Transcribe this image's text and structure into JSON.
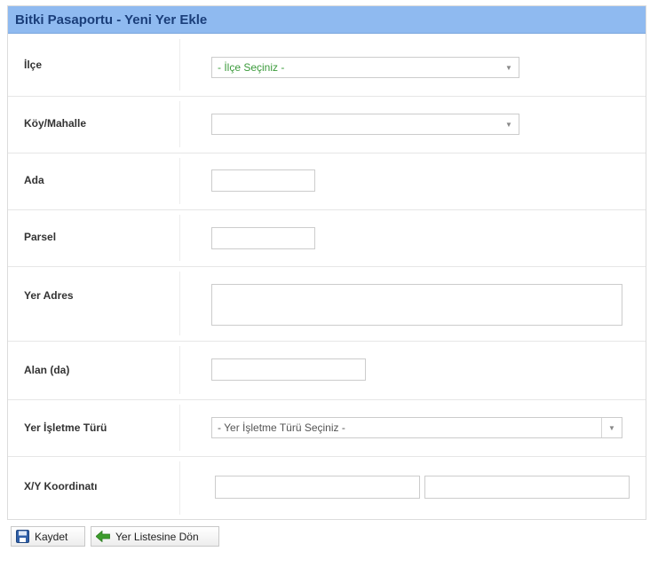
{
  "panel": {
    "title": "Bitki Pasaportu - Yeni Yer Ekle"
  },
  "form": {
    "ilce": {
      "label": "İlçe",
      "value": "- İlçe Seçiniz -"
    },
    "koy_mahalle": {
      "label": "Köy/Mahalle",
      "value": ""
    },
    "ada": {
      "label": "Ada",
      "value": ""
    },
    "parsel": {
      "label": "Parsel",
      "value": ""
    },
    "yer_adres": {
      "label": "Yer Adres",
      "value": ""
    },
    "alan": {
      "label": "Alan (da)",
      "value": ""
    },
    "yer_isletme_turu": {
      "label": "Yer İşletme Türü",
      "value": "- Yer İşletme Türü Seçiniz -"
    },
    "koordinat": {
      "label": "X/Y Koordinatı",
      "x_value": "",
      "y_value": ""
    }
  },
  "buttons": {
    "save_label": "Kaydet",
    "back_label": "Yer Listesine Dön"
  },
  "icons": {
    "select_arrow": "chevron-down-icon",
    "save": "floppy-disk-icon",
    "back": "arrow-left-icon"
  },
  "colors": {
    "header_bg": "#8fbaf0",
    "header_text": "#1a3e7a",
    "placeholder_green": "#3a9a3a",
    "back_arrow_green": "#3c9c2c",
    "save_icon_blue": "#2f5fa8"
  }
}
